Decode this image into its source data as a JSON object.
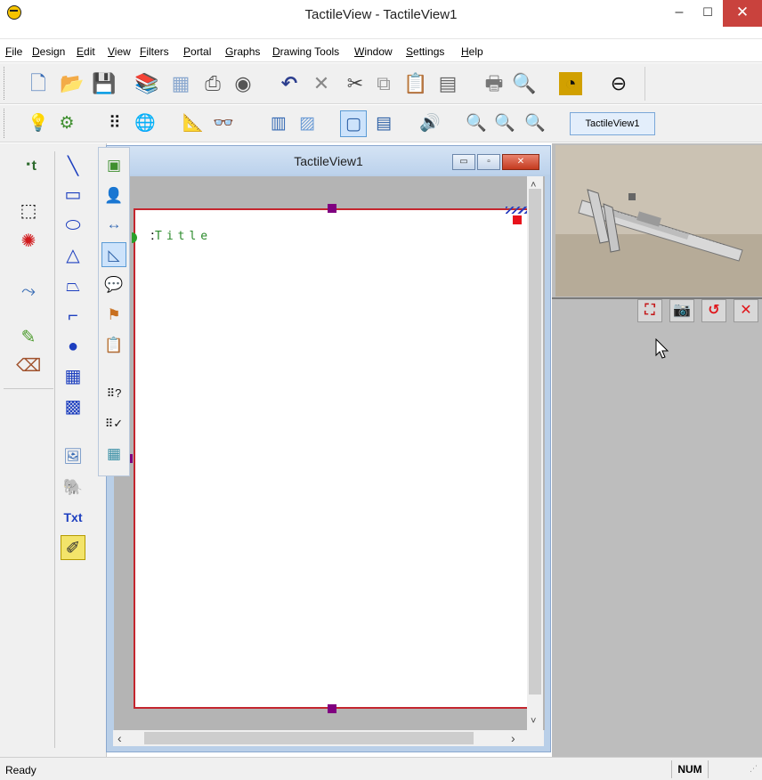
{
  "app": {
    "title": "TactileView - TactileView1",
    "minimize_glyph": "–",
    "maximize_glyph": "☐",
    "close_glyph": "✕"
  },
  "menu": [
    "File",
    "Design",
    "Edit",
    "View",
    "Filters",
    "Portal",
    "Graphs",
    "Drawing Tools",
    "Window",
    "Settings",
    "Help"
  ],
  "toolbar1": {
    "icons": [
      {
        "name": "new-icon",
        "glyph": "🗋"
      },
      {
        "name": "open-icon",
        "glyph": "📂"
      },
      {
        "name": "save-icon",
        "glyph": "💾"
      },
      {
        "name": "library-icon",
        "glyph": "📚"
      },
      {
        "name": "image-gallery-icon",
        "glyph": "▦"
      },
      {
        "name": "scanner-icon",
        "glyph": "⎙"
      },
      {
        "name": "webcam-icon",
        "glyph": "◉"
      },
      {
        "name": "undo-icon",
        "glyph": "↶"
      },
      {
        "name": "delete-icon",
        "glyph": "✕"
      },
      {
        "name": "cut-icon",
        "glyph": "✂"
      },
      {
        "name": "copy-icon",
        "glyph": "⧉"
      },
      {
        "name": "paste-icon",
        "glyph": "📋"
      },
      {
        "name": "paste-special-icon",
        "glyph": "▤"
      },
      {
        "name": "print-icon",
        "glyph": "🖶"
      },
      {
        "name": "print-preview-icon",
        "glyph": "🔍"
      },
      {
        "name": "rss-feed-icon",
        "glyph": "◔"
      },
      {
        "name": "tactileview-logo-icon",
        "glyph": "⊖"
      }
    ]
  },
  "toolbar2": {
    "icons": [
      {
        "name": "tip-bulb-icon",
        "glyph": "💡"
      },
      {
        "name": "settings-brush-icon",
        "glyph": "⚙"
      },
      {
        "name": "braille-dots-icon",
        "glyph": "⠿"
      },
      {
        "name": "globe-icon",
        "glyph": "🌐"
      },
      {
        "name": "measure-icon",
        "glyph": "📐"
      },
      {
        "name": "glasses-icon",
        "glyph": "👓"
      },
      {
        "name": "braille-page-icon",
        "glyph": "▥"
      },
      {
        "name": "pattern-icon",
        "glyph": "▨"
      },
      {
        "name": "page-view-icon",
        "glyph": "▢"
      },
      {
        "name": "braille-view-icon",
        "glyph": "▤"
      },
      {
        "name": "audio-icon",
        "glyph": "🔊"
      },
      {
        "name": "zoom-out-icon",
        "glyph": "🔍"
      },
      {
        "name": "zoom-in-icon",
        "glyph": "🔍"
      },
      {
        "name": "zoom-fit-icon",
        "glyph": "🔍"
      }
    ],
    "window_label": "TactileView1"
  },
  "left_tools_col1": [
    {
      "name": "braille-text-tool-icon",
      "glyph": "⠐t"
    },
    {
      "name": "select-rectangle-tool-icon",
      "glyph": "⬚"
    },
    {
      "name": "lasso-select-tool-icon",
      "glyph": "✺"
    },
    {
      "name": "connector-tool-icon",
      "glyph": "⤳"
    },
    {
      "name": "pencil-tool-icon",
      "glyph": "✎"
    },
    {
      "name": "eraser-tool-icon",
      "glyph": "⌫"
    }
  ],
  "left_tools_col2": [
    {
      "name": "line-tool-icon",
      "glyph": "╲"
    },
    {
      "name": "rectangle-tool-icon",
      "glyph": "▭"
    },
    {
      "name": "ellipse-tool-icon",
      "glyph": "⬭"
    },
    {
      "name": "triangle-tool-icon",
      "glyph": "△"
    },
    {
      "name": "trapezoid-tool-icon",
      "glyph": "⏢"
    },
    {
      "name": "polyline-tool-icon",
      "glyph": "⌐"
    },
    {
      "name": "dot-tool-icon",
      "glyph": "●"
    },
    {
      "name": "table-tool-icon",
      "glyph": "▦"
    },
    {
      "name": "chart-grid-tool-icon",
      "glyph": "▩"
    },
    {
      "name": "insert-image-tool-icon",
      "glyph": "🖼"
    },
    {
      "name": "elephant-image-tool-icon",
      "glyph": "🐘"
    },
    {
      "name": "text-tool-label",
      "glyph": "Txt"
    },
    {
      "name": "audio-pen-tool-icon",
      "glyph": "✐"
    }
  ],
  "doc_tools": [
    {
      "name": "document-properties-icon",
      "glyph": "▣"
    },
    {
      "name": "user-profile-icon",
      "glyph": "👤"
    },
    {
      "name": "page-size-icon",
      "glyph": "↔"
    },
    {
      "name": "page-layout-icon",
      "glyph": "◺",
      "active": true
    },
    {
      "name": "speech-bubble-icon",
      "glyph": "💬"
    },
    {
      "name": "layers-icon",
      "glyph": "⚑"
    },
    {
      "name": "clipboard-icon",
      "glyph": "📋"
    },
    {
      "name": "braille-check-icon",
      "glyph": "⠿?"
    },
    {
      "name": "braille-verify-icon",
      "glyph": "⠿✓"
    },
    {
      "name": "texture-grid-icon",
      "glyph": "▦"
    }
  ],
  "document": {
    "title": "TactileView1",
    "min_glyph": "▭",
    "restore_glyph": "▫",
    "close_glyph": "✕",
    "page_title_text": "Title",
    "title_braille_marker": "⠅",
    "scroll_up": "˄",
    "scroll_down": "˅",
    "scroll_left": "‹",
    "scroll_right": "›"
  },
  "camera": {
    "buttons": [
      {
        "name": "fullscreen-button",
        "glyph": "⛶"
      },
      {
        "name": "capture-button",
        "glyph": "📷"
      },
      {
        "name": "refresh-button",
        "glyph": "↺"
      },
      {
        "name": "close-camera-button",
        "glyph": "✕"
      }
    ]
  },
  "status": {
    "text": "Ready",
    "num": "NUM",
    "grip": "⋰"
  },
  "colors": {
    "page_border": "#c4262e",
    "handle": "#800080",
    "title_text": "#2a8a2a",
    "camera_button": "#e0161b"
  }
}
